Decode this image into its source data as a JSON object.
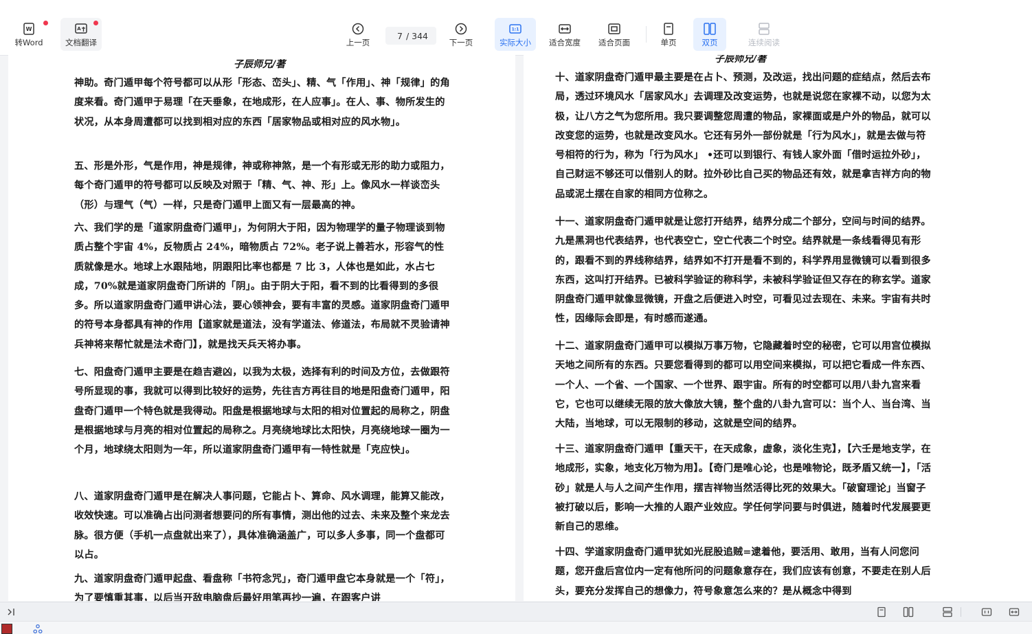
{
  "toolbar": {
    "to_word": "转Word",
    "translate": "文档翻译",
    "prev_page": "上一页",
    "next_page": "下一页",
    "page_current": "7",
    "page_total": "/ 344",
    "actual_size": "实际大小",
    "actual_size_badge": "1:1",
    "fit_width": "适合宽度",
    "fit_page": "适合页面",
    "single_page": "单页",
    "double_page": "双页",
    "continuous": "连续阅读"
  },
  "left_page": {
    "header": "子辰师兄/著",
    "paragraphs": [
      "神助。奇门遁甲每个符号都可以从形「形态、峦头」、精、气「作用」、神「规律」的角度来看。奇门遁甲于易理「在天垂象，在地成形，在人应事」。在人、事、物所发生的状况，从本身周遭都可以找到相对应的东西「居家物品或相对应的风水物」。",
      "五、形是外形，气是作用，神是规律，神或称神煞，是一个有形或无形的助力或阻力，每个奇门遁甲的符号都可以反映及对照于「精、气、神、形」上。像风水一样谈峦头（形）与理气（气）一样，只是奇门遁甲上面又有一层最高的神。",
      "六、我们学的是「道家阴盘奇门遁甲」，为何阴大于阳，因为物理学的量子物理谈到物质占整个宇宙 4%，反物质占 24%，暗物质占 72%。老子说上善若水，形容气的性质就像是水。地球上水跟陆地，阴跟阳比率也都是 7 比 3，人体也是如此，水占七成，70%就是道家阴盘奇门所讲的「阴」。由于阴大于阳，看不到的比看得到的多很多。所以道家阴盘奇门遁甲讲心法，要心领神会，要有丰富的灵感。道家阴盘奇门遁甲的符号本身都具有神的作用【道家就是道法，没有学道法、修道法，布局就不灵验请神兵神将来帮忙就是法术奇门】，就是找天兵天将办事。",
      "七、阳盘奇门遁甲主要是在趋吉避凶，以我为太极，选择有利的时间及方位，去做跟符号所显现的事，我就可以得到比较好的运势，先往吉方再往目的地是阳盘奇门遁甲，阳盘奇门遁甲一个特色就是我得动。阳盘是根据地球与太阳的相对位置起的局称之，阴盘是根据地球与月亮的相对位置起的局称之。月亮绕地球比太阳快，月亮绕地球一圈为一个月，地球绕太阳则为一年，所以道家阴盘奇门遁甲有一特性就是「克应快」。",
      "八、道家阴盘奇门遁甲是在解决人事问题，它能占卜、算命、风水调理，能算又能改，收效快速。可以准确占出问测者想要问的所有事情，测出他的过去、未来及整个来龙去脉。很方便（手机一点盘就出来了），具体准确涵盖广，可以多人多事，同一个盘都可以占。",
      "九、道家阴盘奇门遁甲起盘、看盘称「书符念咒」，奇门遁甲盘它本身就是一个「符」，为了要慎重其事，以后当开敌电脑盘后最好用笔再抄一遍，在跟客户讲"
    ]
  },
  "right_page": {
    "header": "子辰师兄/著",
    "paragraphs": [
      "十、道家阴盘奇门遁甲最主要是在占卜、预测，及改运，找出问题的症结点，然后去布局，透过环境风水「居家风水」去调理及改变运势，也就是说您在家裸不动，以您为太极，让八方之气为您所用。我只要调整您周遭的物品，家裸面或是户外的物品，就可以改变您的运势，也就是改变风水。它还有另外一部份就是「行为风水」，就是去做与符号相符的行为，称为「行为风水」 •还可以到银行、有钱人家外面「借时运拉外砂」，自己财运不够还可以借别人的财。拉外砂比自己买的物品还有效，就是拿吉祥方向的物品或泥土摆在自家的相同方位称之。",
      "十一、道家阴盘奇门遁甲就是让您打开结界，结界分成二个部分，空间与时间的结界。九是黑洞也代表结界，也代表空亡，空亡代表二个时空。结界就是一条线看得见有形的，跟看不到的界线称结界，结界如不打开是看不到的，科学界用显微镜可以看到很多东西，这叫打开结界。已被科学验证的称科学，未被科学验证但又存在的称玄学。道家阴盘奇门遁甲就像显微镜，开盘之后便进入时空，可看见过去现在、未来。宇宙有共时性，因缘际会即是，有时感而遂通。",
      "十二、道家阴盘奇门遁甲可以模拟万事万物，它隐藏着时空的秘密，它可以用宫位模拟天地之间所有的东西。只要您看得到的都可以用空间来模拟，可以把它看成一件东西、一个人、一个省、一个国家、一个世界、跟宇宙。所有的时空都可以用八卦九宫来看它，它也可以继续无限的放大像放大镜，整个盘的八卦九宫可以：当个人、当台湾、当大陆，当地球，可以无限制的移动，这就是空间的结界。",
      "十三、道家阴盘奇门遁甲【重天干，在天成象，虚象，淡化生克】，【六壬是地支学，在地成形，实象，地支化万物为用】。【奇门是唯心论，也是唯物论，既矛盾又统一】，「活砂」就是人与人之间产生作用，摆吉祥物当然活得比死的效果大。「破窗理论」当窗子被打破以后，影响一大推的人跟产业效应。学任何学问要与时俱进，随着时代发展要更新自己的思维。",
      "十四、学道家阴盘奇门遁甲犹如光屁股追贼=逮着他，要活用、敢用，当有人问您问题，您开盘后宫位内一定有他所问的问题象意存在，我们应该有创意，不要走在别人后头，要充分发挥自己的想像力，符号象意怎么来的？是从概念中得到"
    ]
  },
  "colors": {
    "accent": "#2b72f0",
    "badge": "#f0374e",
    "active_bg": "#e8f1ff"
  }
}
